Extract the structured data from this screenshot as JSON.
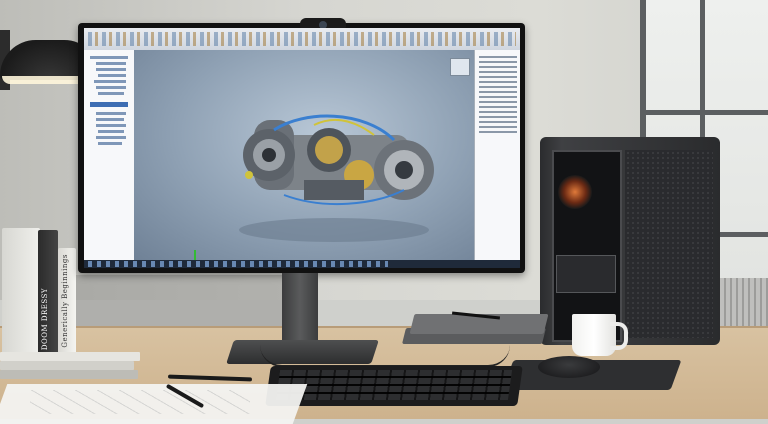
{
  "scene": {
    "description_tag": "cad-workstation-desk",
    "colors": {
      "wall": "#d6d6d1",
      "desk_wood": "#d2b895",
      "monitor_bezel": "#111111",
      "viewport_bg": "#9fb1c3",
      "tower_case": "#2f3033",
      "fan_glow": "#e07a3a"
    }
  },
  "books": [
    {
      "spine": ""
    },
    {
      "spine": "DOOM DRESSY"
    },
    {
      "spine": "Generically Beginnings"
    }
  ],
  "cad_app": {
    "viewport_subject": "gearbox-assembly-model",
    "left_tree_rows": 14,
    "right_property_rows": 16
  }
}
